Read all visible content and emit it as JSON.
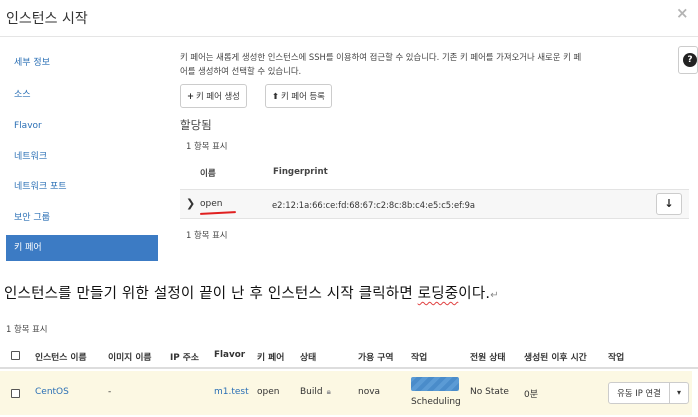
{
  "modal": {
    "title": "인스턴스 시작",
    "close_icon": "×",
    "sidebar": {
      "items": [
        {
          "label": "세부 정보",
          "active": false
        },
        {
          "label": "소스",
          "active": false
        },
        {
          "label": "Flavor",
          "active": false
        },
        {
          "label": "네트워크",
          "active": false
        },
        {
          "label": "네트워크 포트",
          "active": false
        },
        {
          "label": "보안 그룹",
          "active": false
        },
        {
          "label": "키 페어",
          "active": true
        }
      ]
    },
    "content": {
      "description_line1": "키 페어는 새롭게 생성한 인스턴스에 SSH를 이용하여 접근할 수 있습니다. 기존 키 페어를 가져오거나 새로운 키 페",
      "description_line2": "어를 생성하여 선택할 수 있습니다.",
      "help_icon": "?",
      "create_button": {
        "icon": "+",
        "label": "키 페어 생성"
      },
      "import_button": {
        "icon": "⬆",
        "label": "키 페어 등록"
      },
      "allocated_title": "할당됨",
      "allocated_count": "1 항목 표시",
      "columns": {
        "name": "이름",
        "fingerprint": "Fingerprint"
      },
      "rows": [
        {
          "name": "open",
          "fingerprint": "e2:12:1a:66:ce:fd:68:67:c2:8c:8b:c4:e5:c5:ef:9a"
        }
      ],
      "allocated_count_bottom": "1 항목 표시"
    }
  },
  "caption": {
    "text": "인스턴스를 만들기 위한 설정이 끝이 난 후 인스턴스 시작 클릭하면 ",
    "highlight": "로딩중",
    "tail": "이다."
  },
  "instances": {
    "count": "1 항목 표시",
    "columns": [
      "인스턴스 이름",
      "이미지 이름",
      "IP 주소",
      "Flavor",
      "키 페어",
      "상태",
      "가용 구역",
      "작업",
      "전원 상태",
      "생성된 이후 시간",
      "작업"
    ],
    "rows": [
      {
        "name": "CentOS",
        "image": "-",
        "ip": "",
        "flavor": "m1.test",
        "keypair": "open",
        "status": "Build",
        "zone": "nova",
        "task": "Scheduling",
        "power": "No State",
        "age": "0분",
        "action": "유동 IP 연결"
      }
    ]
  },
  "colors": {
    "accent": "#3c7bc4",
    "link": "#2a6fb5",
    "row_highlight": "#fcf8e3",
    "underline": "#e02020"
  }
}
